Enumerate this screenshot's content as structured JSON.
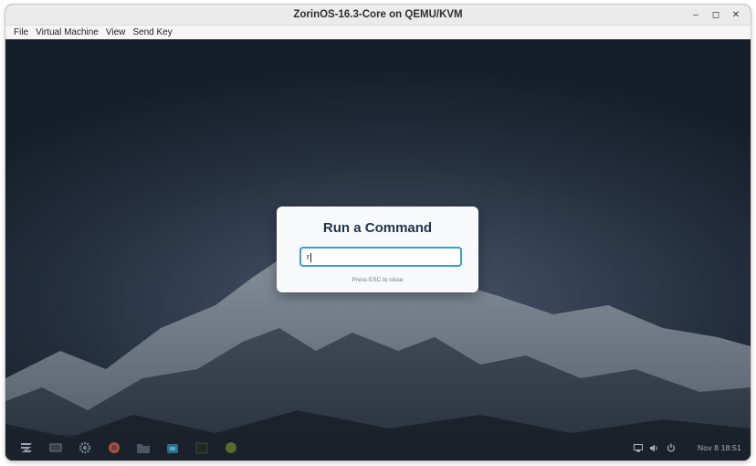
{
  "window": {
    "title": "ZorinOS-16.3-Core on QEMU/KVM"
  },
  "window_controls": {
    "minimize": "–",
    "maximize": "◻",
    "close": "✕"
  },
  "menubar": {
    "items": [
      "File",
      "Virtual Machine",
      "View",
      "Send Key"
    ]
  },
  "dialog": {
    "title": "Run a Command",
    "input_value": "r",
    "hint": "Press ESC to close"
  },
  "taskbar": {
    "icons": [
      "zorin-menu-icon",
      "window-icon",
      "settings-icon",
      "firefox-icon",
      "files-icon",
      "software-store-icon",
      "terminal-icon",
      "app-icon"
    ],
    "clock": "Nov 8  18:51"
  },
  "colors": {
    "accent": "#3aa0c8",
    "dialog_title": "#1f3347"
  }
}
